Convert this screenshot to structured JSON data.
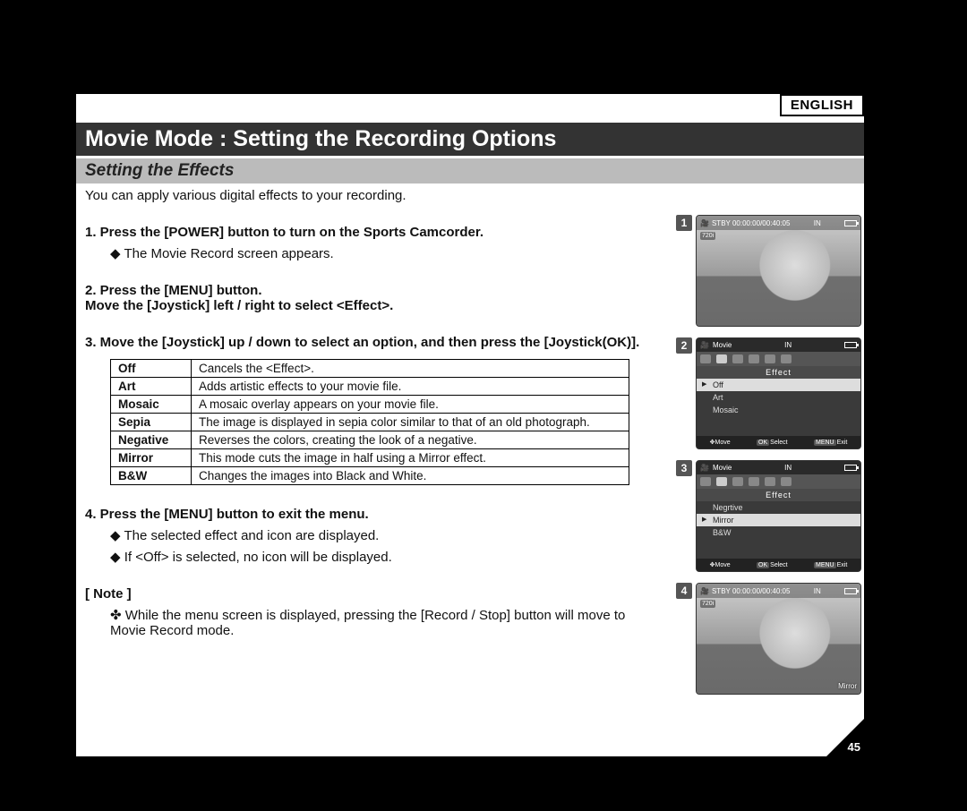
{
  "language": "ENGLISH",
  "title": "Movie Mode : Setting the Recording Options",
  "subtitle": "Setting the Effects",
  "intro": "You can apply various digital effects to your recording.",
  "steps": {
    "s1_title": "1. Press the [POWER] button to turn on the Sports Camcorder.",
    "s1_sub1": "The Movie Record screen appears.",
    "s2_title_a": "2. Press the [MENU] button.",
    "s2_title_b": "Move the [Joystick] left / right to select <Effect>.",
    "s3_title": "3. Move the [Joystick] up / down to select an option, and then press the [Joystick(OK)].",
    "s4_title": "4. Press the [MENU] button to exit the menu.",
    "s4_sub1": "The selected effect and icon are displayed.",
    "s4_sub2": "If <Off> is selected, no icon will be displayed."
  },
  "effects_table": [
    {
      "name": "Off",
      "desc": "Cancels the <Effect>."
    },
    {
      "name": "Art",
      "desc": "Adds artistic effects to your movie file."
    },
    {
      "name": "Mosaic",
      "desc": "A mosaic overlay appears on your movie file."
    },
    {
      "name": "Sepia",
      "desc": "The image is displayed in sepia color similar to that of an old photograph."
    },
    {
      "name": "Negative",
      "desc": "Reverses the colors, creating the look of a negative."
    },
    {
      "name": "Mirror",
      "desc": "This mode cuts the image in half using a Mirror effect."
    },
    {
      "name": "B&W",
      "desc": "Changes the images into Black and White."
    }
  ],
  "note_label": "[ Note ]",
  "note_text": "While the menu screen is displayed, pressing the [Record / Stop] button will move to Movie Record mode.",
  "figures": {
    "f1": {
      "num": "1",
      "status": "STBY 00:00:00/00:40:05",
      "res": "720i",
      "mem": "IN"
    },
    "f2": {
      "num": "2",
      "mode": "Movie",
      "menu": "Effect",
      "items": [
        "Off",
        "Art",
        "Mosaic"
      ],
      "selected": "Off",
      "foot_move": "Move",
      "foot_select": "Select",
      "foot_exit": "Exit",
      "key_ok": "OK",
      "key_menu": "MENU",
      "mem": "IN"
    },
    "f3": {
      "num": "3",
      "mode": "Movie",
      "menu": "Effect",
      "items": [
        "Negrtive",
        "Mirror",
        "B&W"
      ],
      "selected": "Mirror",
      "foot_move": "Move",
      "foot_select": "Select",
      "foot_exit": "Exit",
      "key_ok": "OK",
      "key_menu": "MENU",
      "mem": "IN"
    },
    "f4": {
      "num": "4",
      "status": "STBY 00:00:00/00:40:05",
      "res": "720i",
      "overlay": "Mirror",
      "mem": "IN"
    }
  },
  "page_number": "45"
}
